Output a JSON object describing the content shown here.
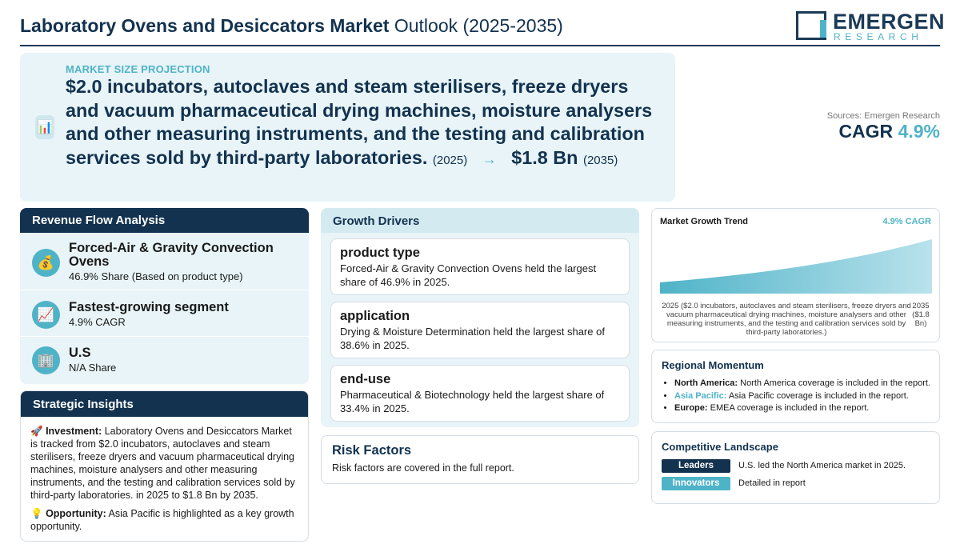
{
  "header": {
    "title_bold": "Laboratory Ovens and Desiccators Market",
    "title_light": "Outlook (2025-2035)",
    "logo_name": "EMERGEN",
    "logo_sub": "RESEARCH"
  },
  "hero": {
    "icon": "bar-chart-icon",
    "label": "MARKET SIZE PROJECTION",
    "start_value": "$2.0 incubators, autoclaves and steam sterilisers, freeze dryers and vacuum pharmaceutical drying machines, moisture analysers and other measuring instruments, and the testing and calibration services sold by third-party laboratories.",
    "start_year": "(2025)",
    "arrow": "→",
    "end_value": "$1.8 Bn",
    "end_year": "(2035)"
  },
  "summary": {
    "sources": "Sources: Emergen Research",
    "cagr_label": "CAGR",
    "cagr_value": "4.9%"
  },
  "revenue_flow": {
    "title": "Revenue Flow Analysis",
    "items": [
      {
        "icon": "money-bag-icon",
        "title": "Forced-Air & Gravity Convection Ovens",
        "sub": "46.9% Share (Based on product type)"
      },
      {
        "icon": "trend-chart-icon",
        "title": "Fastest-growing segment",
        "sub": "4.9% CAGR"
      },
      {
        "icon": "building-icon",
        "title": "U.S",
        "sub": "N/A Share"
      }
    ]
  },
  "strategic": {
    "title": "Strategic Insights",
    "investment_label": "Investment:",
    "investment_text": "Laboratory Ovens and Desiccators Market is tracked from $2.0 incubators, autoclaves and steam sterilisers, freeze dryers and vacuum pharmaceutical drying machines, moisture analysers and other measuring instruments, and the testing and calibration services sold by third-party laboratories. in 2025 to $1.8 Bn by 2035.",
    "opportunity_label": "Opportunity:",
    "opportunity_text": "Asia Pacific is highlighted as a key growth opportunity."
  },
  "drivers": {
    "title": "Growth Drivers",
    "cards": [
      {
        "title": "product type",
        "text": "Forced-Air & Gravity Convection Ovens held the largest share of 46.9% in 2025."
      },
      {
        "title": "application",
        "text": "Drying & Moisture Determination held the largest share of 38.6% in 2025."
      },
      {
        "title": "end-use",
        "text": "Pharmaceutical & Biotechnology held the largest share of 33.4% in 2025."
      }
    ]
  },
  "risk": {
    "title": "Risk Factors",
    "text": "Risk factors are covered in the full report."
  },
  "trend": {
    "title": "Market Growth Trend",
    "cagr": "4.9% CAGR",
    "x_start": "2025 ($2.0 incubators, autoclaves and steam sterilisers, freeze dryers and vacuum pharmaceutical drying machines, moisture analysers and other measuring instruments, and the testing and calibration services sold by third-party laboratories.)",
    "x_end": "2035 ($1.8 Bn)",
    "color_start": "#4fb3c8",
    "color_end": "#b9e2ec"
  },
  "chart_data": {
    "type": "area",
    "title": "Market Growth Trend",
    "x": [
      "2025",
      "2035"
    ],
    "series": [
      {
        "values": [
          2.0,
          1.8
        ]
      }
    ],
    "annotation": "4.9% CAGR",
    "grid": false
  },
  "regional": {
    "title": "Regional Momentum",
    "items": [
      {
        "region": "North America:",
        "text": "North America coverage is included in the report."
      },
      {
        "region": "Asia Pacific:",
        "text": "Asia Pacific coverage is included in the report."
      },
      {
        "region": "Europe:",
        "text": "EMEA coverage is included in the report."
      }
    ]
  },
  "competitive": {
    "title": "Competitive Landscape",
    "rows": [
      {
        "badge": "Leaders",
        "text": "U.S. led the North America market in 2025."
      },
      {
        "badge": "Innovators",
        "text": "Detailed in report"
      }
    ]
  }
}
